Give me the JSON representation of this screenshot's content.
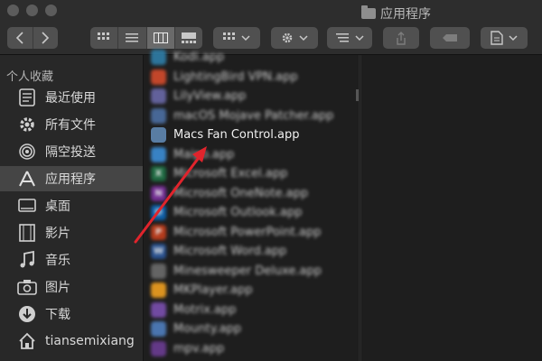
{
  "window": {
    "title": "应用程序"
  },
  "sidebar": {
    "section_title": "个人收藏",
    "items": [
      {
        "label": "最近使用",
        "icon": "recent-icon"
      },
      {
        "label": "所有文件",
        "icon": "gear-icon"
      },
      {
        "label": "隔空投送",
        "icon": "airdrop-icon"
      },
      {
        "label": "应用程序",
        "icon": "app-store-icon",
        "selected": true
      },
      {
        "label": "桌面",
        "icon": "desktop-icon"
      },
      {
        "label": "影片",
        "icon": "film-icon"
      },
      {
        "label": "音乐",
        "icon": "music-icon"
      },
      {
        "label": "图片",
        "icon": "camera-icon"
      },
      {
        "label": "下载",
        "icon": "download-icon"
      },
      {
        "label": "tiansemixiang",
        "icon": "home-icon"
      }
    ]
  },
  "files": [
    {
      "name": "Kodi.app",
      "icon": "kodi-icon",
      "color": "#2f7ea8"
    },
    {
      "name": "LightingBird VPN.app",
      "icon": "bird-icon",
      "color": "#d44b2c"
    },
    {
      "name": "LilyView.app",
      "icon": "lily-icon",
      "color": "#6a69a8"
    },
    {
      "name": "macOS Mojave Patcher.app",
      "icon": "patcher-icon",
      "color": "#4c6fa3"
    },
    {
      "name": "Macs Fan Control.app",
      "icon": "fan-icon",
      "color": "#597da3",
      "focused": true
    },
    {
      "name": "Maipo.app",
      "icon": "weather-icon",
      "color": "#3b8dd6"
    },
    {
      "name": "Microsoft Excel.app",
      "icon": "excel-icon",
      "color": "#1e7145",
      "glyph": "X"
    },
    {
      "name": "Microsoft OneNote.app",
      "icon": "onenote-icon",
      "color": "#7b2f9e",
      "glyph": "N"
    },
    {
      "name": "Microsoft Outlook.app",
      "icon": "outlook-icon",
      "color": "#0c64b5",
      "glyph": "O"
    },
    {
      "name": "Microsoft PowerPoint.app",
      "icon": "powerpoint-icon",
      "color": "#c43e1c",
      "glyph": "P"
    },
    {
      "name": "Microsoft Word.app",
      "icon": "word-icon",
      "color": "#2b579a",
      "glyph": "W"
    },
    {
      "name": "Minesweeper Deluxe.app",
      "icon": "minesweeper-icon",
      "color": "#6c6c6c"
    },
    {
      "name": "MKPlayer.app",
      "icon": "player-icon",
      "color": "#f0a020"
    },
    {
      "name": "Motrix.app",
      "icon": "motrix-icon",
      "color": "#7b4fb0"
    },
    {
      "name": "Mounty.app",
      "icon": "mounty-icon",
      "color": "#4f7fbf"
    },
    {
      "name": "mpv.app",
      "icon": "mpv-icon",
      "color": "#6b3c93"
    }
  ],
  "annotation": {
    "color": "#e0242c"
  }
}
